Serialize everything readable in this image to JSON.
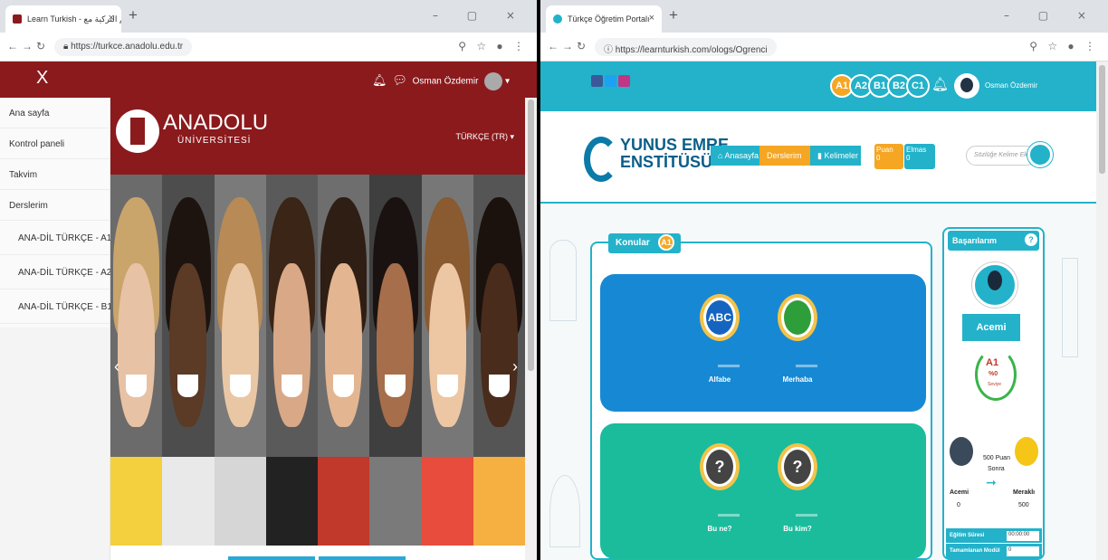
{
  "left_window": {
    "tab_title": "Learn Turkish - تعلم التركية مع...",
    "url": "https://turkce.anadolu.edu.tr",
    "close_menu": "X",
    "user_name": "Osman Özdemir",
    "brand_title": "ANADOLU",
    "brand_subtitle": "ÜNİVERSİTESİ",
    "language": "TÜRKÇE (TR)",
    "sidebar": [
      {
        "label": "Ana sayfa",
        "level": 0
      },
      {
        "label": "Kontrol paneli",
        "level": 0
      },
      {
        "label": "Takvim",
        "level": 0
      },
      {
        "label": "Derslerim",
        "level": 0
      },
      {
        "label": "ANA-DİL TÜRKÇE - A1",
        "level": 1
      },
      {
        "label": "ANA-DİL TÜRKÇE - A2",
        "level": 1
      },
      {
        "label": "ANA-DİL TÜRKÇE - B1",
        "level": 1
      }
    ],
    "icons": {
      "bell": "bell-icon",
      "chat": "chat-icon",
      "prev": "chevron-left-icon",
      "next": "chevron-right-icon"
    }
  },
  "right_window": {
    "tab_title": "Türkçe Öğretim Portalı",
    "url": "https://learnturkish.com/ologs/Ogrenci",
    "levels": [
      "A1",
      "A2",
      "B1",
      "B2",
      "C1"
    ],
    "user_name": "Osman Özdemir",
    "logo_line1": "YUNUS EMRE",
    "logo_line2": "ENSTİTÜSÜ",
    "breadcrumb": [
      "Anasayfa",
      "Derslerim",
      "Kelimeler"
    ],
    "points": [
      {
        "label": "Puan",
        "value": "0"
      },
      {
        "label": "Elmas",
        "value": "0"
      }
    ],
    "search_placeholder": "Sözlüğe Kelime Ekle",
    "topics_title": "Konular",
    "topics_level": "A1",
    "cards": [
      {
        "items": [
          {
            "name": "Alfabe",
            "glyph": "ABC"
          },
          {
            "name": "Merhaba",
            "glyph": ""
          }
        ]
      },
      {
        "items": [
          {
            "name": "Bu ne?",
            "glyph": "?"
          },
          {
            "name": "Bu kim?",
            "glyph": "?"
          }
        ]
      }
    ],
    "achievements": {
      "title": "Başarılarım",
      "rank": "Acemi",
      "level": "A1",
      "percent": "%0",
      "level_note": "Seviye",
      "next_text_1": "500 Puan",
      "next_text_2": "Sonra",
      "current_rank": "Acemi",
      "current_points": "0",
      "next_rank": "Meraklı",
      "next_points": "500",
      "table": [
        {
          "label": "Eğitim Süresi",
          "value": "00:00:00"
        },
        {
          "label": "Tamamlanan Modül",
          "value": "0"
        }
      ]
    },
    "colors": {
      "primary": "#23b2ca",
      "orange": "#f5a623",
      "blue_card": "#1789d4",
      "green_card": "#1abc9c"
    }
  },
  "colors": {
    "anadolu_red": "#8b1a1d"
  }
}
